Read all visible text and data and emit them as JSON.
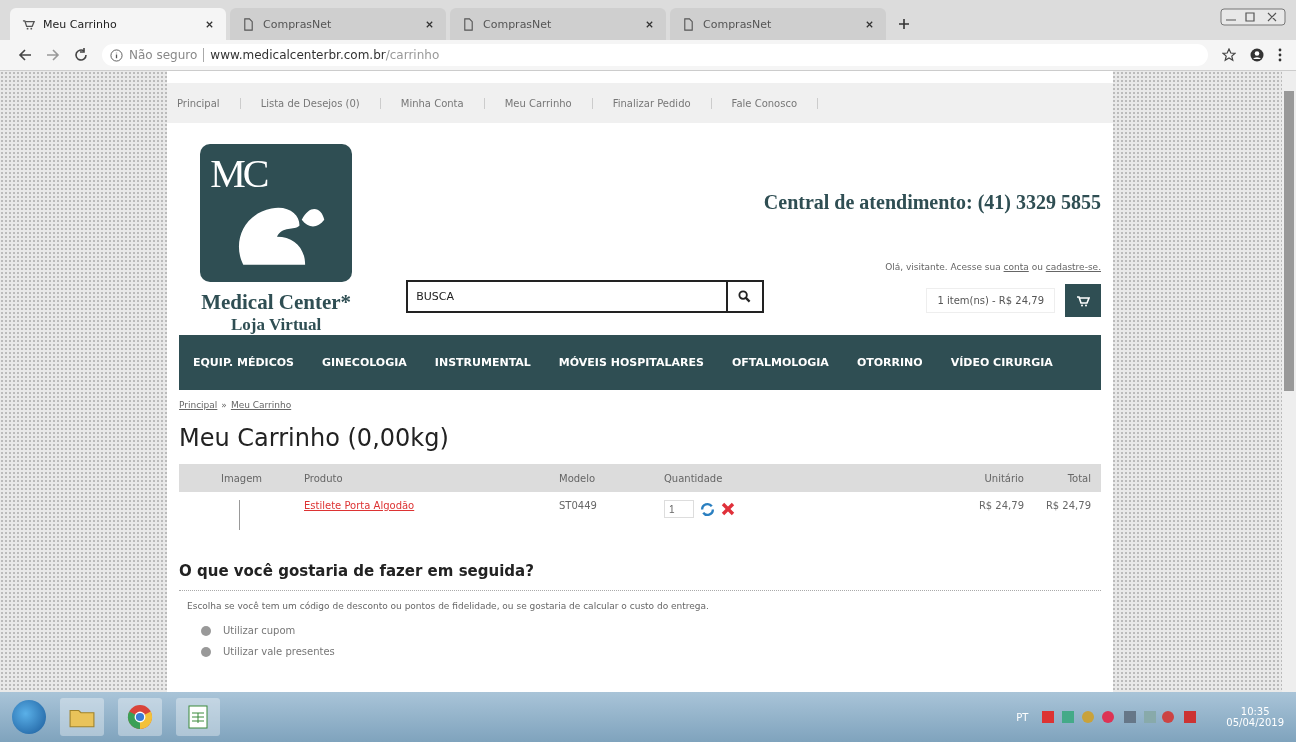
{
  "browser": {
    "tabs": [
      {
        "title": "Meu Carrinho",
        "selected": true,
        "kind": "cart"
      },
      {
        "title": "ComprasNet",
        "selected": false,
        "kind": "page"
      },
      {
        "title": "ComprasNet",
        "selected": false,
        "kind": "page"
      },
      {
        "title": "ComprasNet",
        "selected": false,
        "kind": "page"
      }
    ],
    "security": "Não seguro",
    "url_host": "www.medicalcenterbr.com.br",
    "url_path": "/carrinho"
  },
  "top_links": [
    "Principal",
    "Lista de Desejos (0)",
    "Minha Conta",
    "Meu Carrinho",
    "Finalizar Pedido",
    "Fale Conosco"
  ],
  "logo": {
    "initials": "MC",
    "name": "Medical Center*",
    "subtitle": "Loja Virtual"
  },
  "contact": "Central de atendimento: (41) 3329 5855",
  "greeting": {
    "prefix": "Olá, visitante. Acesse sua",
    "link1": "conta",
    "middle": "ou",
    "link2": "cadastre-se."
  },
  "search": {
    "placeholder": "BUSCA"
  },
  "cart_summary": "1 item(ns) - R$ 24,79",
  "nav": [
    "EQUIP. MÉDICOS",
    "GINECOLOGIA",
    "INSTRUMENTAL",
    "MÓVEIS HOSPITALARES",
    "OFTALMOLOGIA",
    "OTORRINO",
    "VÍDEO CIRURGIA"
  ],
  "breadcrumb": {
    "separator": "»",
    "items": [
      "Principal",
      "Meu Carrinho"
    ]
  },
  "page_title": "Meu Carrinho  (0,00kg)",
  "cart_table": {
    "columns": [
      "Imagem",
      "Produto",
      "Modelo",
      "Quantidade",
      "Unitário",
      "Total"
    ],
    "rows": [
      {
        "product": "Estilete Porta Algodão",
        "model": "ST0449",
        "quantity": "1",
        "unit": "R$ 24,79",
        "total": "R$ 24,79"
      }
    ]
  },
  "next_steps": {
    "heading": "O que você gostaria de fazer em seguida?",
    "text": "Escolha se você tem um código de desconto ou pontos de fidelidade, ou se gostaria de calcular o custo do entrega.",
    "options": [
      {
        "label": "Utilizar cupom",
        "selected": false
      },
      {
        "label": "Utilizar vale presentes",
        "selected": false
      }
    ]
  },
  "taskbar": {
    "language": "PT",
    "time": "10:35",
    "date": "05/04/2019"
  }
}
